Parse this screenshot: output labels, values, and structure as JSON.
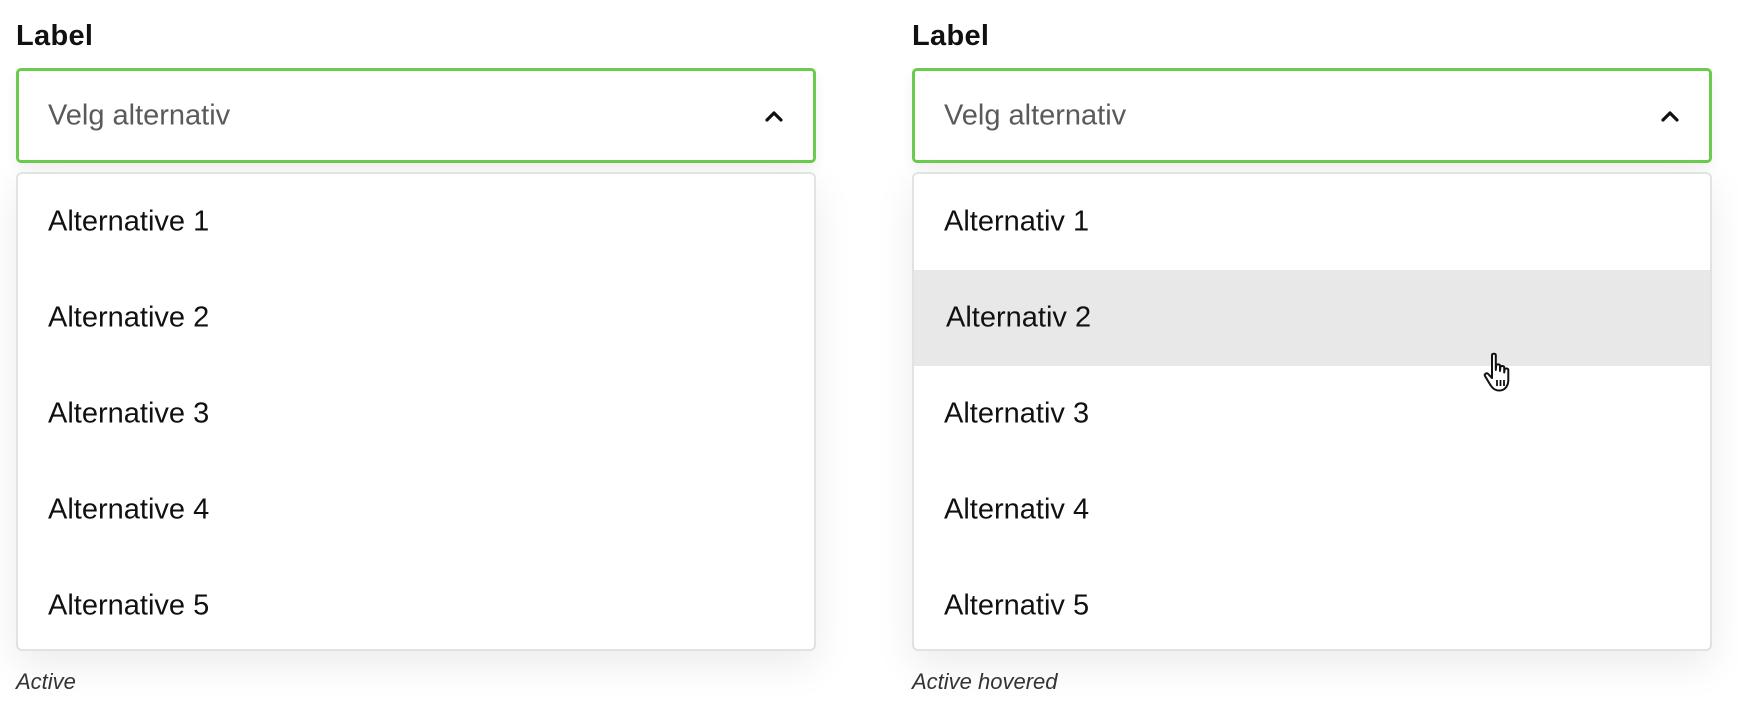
{
  "variants": [
    {
      "label": "Label",
      "placeholder": "Velg alternativ",
      "options": [
        "Alternative 1",
        "Alternative 2",
        "Alternative 3",
        "Alternative 4",
        "Alternative 5"
      ],
      "caption": "Active",
      "state": "open"
    },
    {
      "label": "Label",
      "placeholder": "Velg alternativ",
      "options": [
        "Alternativ 1",
        "Alternativ 2",
        "Alternativ 3",
        "Alternativ 4",
        "Alternativ 5"
      ],
      "caption": "Active hovered",
      "state": "open",
      "hovered_option": "Alternativ 2"
    }
  ],
  "icons": {
    "chevron": "chevron-up-icon",
    "cursor": "hand-pointer-icon"
  },
  "colors": {
    "focus_border": "#6acb4c",
    "hover_background": "#e8e8e8",
    "placeholder_text": "#5a5a5a",
    "dropdown_border": "#e2e2e2"
  }
}
